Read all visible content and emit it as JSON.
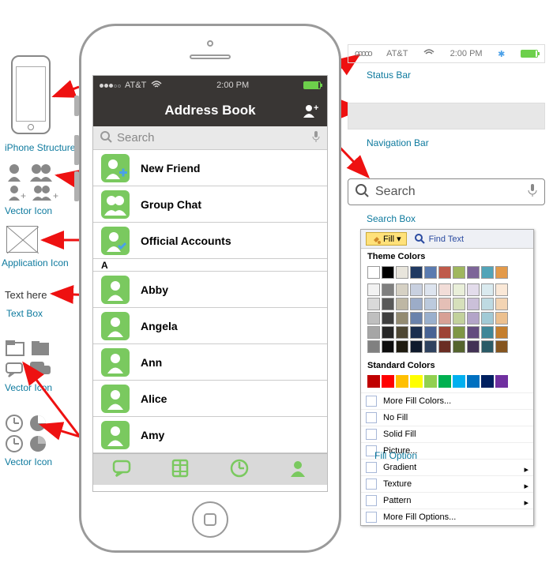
{
  "phone": {
    "status": {
      "carrier": "AT&T",
      "time": "2:00 PM"
    },
    "nav_title": "Address Book",
    "search_placeholder": "Search",
    "top_items": [
      "New Friend",
      "Group Chat",
      "Official Accounts"
    ],
    "section_letter": "A",
    "contacts": [
      "Abby",
      "Angela",
      "Ann",
      "Alice",
      "Amy"
    ]
  },
  "right": {
    "status_bar_label": "Status Bar",
    "nav_bar_label": "Navigation Bar",
    "search_box_label": "Search Box",
    "search_text": "Search",
    "carrier": "AT&T",
    "time": "2:00 PM"
  },
  "fill": {
    "button": "Fill",
    "find_text": "Find Text",
    "theme_title": "Theme Colors",
    "standard_title": "Standard Colors",
    "menu": [
      "More Fill Colors...",
      "No Fill",
      "Solid Fill",
      "Picture...",
      "Gradient",
      "Texture",
      "Pattern",
      "More Fill Options..."
    ],
    "option_label": "Fill Option"
  },
  "left": {
    "iphone": "iPhone Structure",
    "vector_icon": "Vector Icon",
    "app_icon": "Application Icon",
    "text_here": "Text here",
    "text_box": "Text Box"
  },
  "theme_colors_row1": [
    "#ffffff",
    "#000000",
    "#e8e5dc",
    "#203a62",
    "#5a7bb0",
    "#bf5a4a",
    "#9fb75e",
    "#7d6598",
    "#52a4b8",
    "#e39a4a"
  ],
  "theme_shades": [
    [
      "#f2f2f2",
      "#7f7f7f",
      "#d6d1c4",
      "#c8d0e0",
      "#dde4ef",
      "#f2ddd8",
      "#e9efd9",
      "#e3dceb",
      "#daeaef",
      "#fae8d7"
    ],
    [
      "#d9d9d9",
      "#595959",
      "#beb7a4",
      "#9cacc8",
      "#bccadd",
      "#e4bfb6",
      "#d6e0bb",
      "#cbc0d9",
      "#bedae2",
      "#f3d4b3"
    ],
    [
      "#bfbfbf",
      "#3f3f3f",
      "#938b72",
      "#6a82ab",
      "#9ab0cd",
      "#d7a095",
      "#c2d19c",
      "#b3a4c8",
      "#a2cad6",
      "#ecc08f"
    ],
    [
      "#a6a6a6",
      "#262626",
      "#4e4734",
      "#1a2e4e",
      "#486394",
      "#9d4336",
      "#7e9645",
      "#624b7e",
      "#3f8698",
      "#c47e2e"
    ],
    [
      "#808080",
      "#0d0d0d",
      "#1f1b10",
      "#0f1a2c",
      "#2f425f",
      "#6a2d24",
      "#55642e",
      "#423255",
      "#2a5a66",
      "#85551f"
    ]
  ],
  "standard_colors": [
    "#c00000",
    "#ff0000",
    "#ffc000",
    "#ffff00",
    "#92d050",
    "#00b050",
    "#00b0f0",
    "#0070c0",
    "#002060",
    "#7030a0"
  ]
}
